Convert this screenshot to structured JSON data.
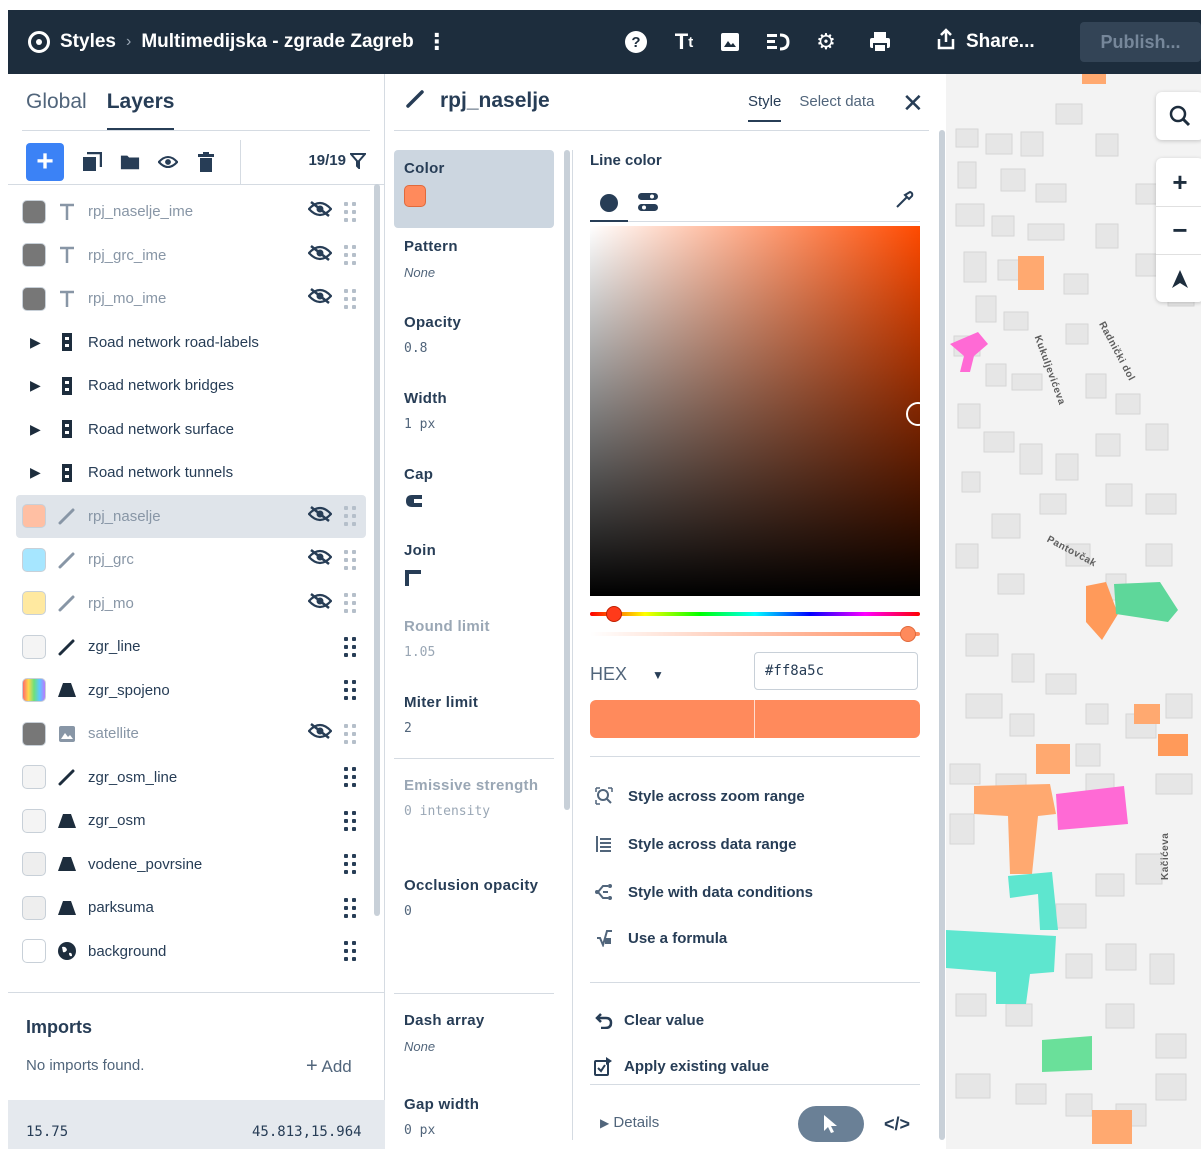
{
  "topbar": {
    "app": "Styles",
    "separator": ">",
    "project": "Multimedijska - zgrade Zagreb",
    "share": "Share...",
    "publish": "Publish...",
    "icons": [
      "help-icon",
      "typography-icon",
      "image-icon",
      "import-icon",
      "settings-icon",
      "print-icon",
      "share-icon"
    ]
  },
  "left": {
    "tabs": [
      "Global",
      "Layers"
    ],
    "active_tab": "Layers",
    "count": "19/19",
    "layers": [
      {
        "name": "rpj_naselje_ime",
        "icon": "text",
        "swatch": "#777777",
        "hidden": true
      },
      {
        "name": "rpj_grc_ime",
        "icon": "text",
        "swatch": "#777777",
        "hidden": true
      },
      {
        "name": "rpj_mo_ime",
        "icon": "text",
        "swatch": "#777777",
        "hidden": true
      },
      {
        "name": "Road network road-labels",
        "icon": "group",
        "group": true
      },
      {
        "name": "Road network bridges",
        "icon": "group",
        "group": true
      },
      {
        "name": "Road network surface",
        "icon": "group",
        "group": true
      },
      {
        "name": "Road network tunnels",
        "icon": "group",
        "group": true
      },
      {
        "name": "rpj_naselje",
        "icon": "line",
        "swatch": "#ffbfa3",
        "hidden": true,
        "selected": true
      },
      {
        "name": "rpj_grc",
        "icon": "line",
        "swatch": "#a6e6ff",
        "hidden": true
      },
      {
        "name": "rpj_mo",
        "icon": "line",
        "swatch": "#ffe9a0",
        "hidden": true
      },
      {
        "name": "zgr_line",
        "icon": "line",
        "swatch": "#f4f4f4"
      },
      {
        "name": "zgr_spojeno",
        "icon": "fill",
        "swatch": "rainbow"
      },
      {
        "name": "satellite",
        "icon": "raster",
        "swatch": "#777777",
        "hidden": true
      },
      {
        "name": "zgr_osm_line",
        "icon": "line",
        "swatch": "#f4f4f4"
      },
      {
        "name": "zgr_osm",
        "icon": "fill",
        "swatch": "#f4f4f4"
      },
      {
        "name": "vodene_povrsine",
        "icon": "fill",
        "swatch": "#eeeeee"
      },
      {
        "name": "parksuma",
        "icon": "fill",
        "swatch": "#eeeeee"
      },
      {
        "name": "background",
        "icon": "globe",
        "swatch": "#ffffff"
      }
    ],
    "imports": {
      "title": "Imports",
      "none": "No imports found.",
      "add": "Add"
    },
    "status": {
      "zoom": "15.75",
      "coords": "45.813,15.964"
    }
  },
  "mid": {
    "layer_name": "rpj_naselje",
    "tabs": [
      "Style",
      "Select data"
    ],
    "active_tab": "Style",
    "props": [
      {
        "label": "Color",
        "type": "swatch",
        "value": "#ff8a5c",
        "selected": true
      },
      {
        "label": "Pattern",
        "value": "None",
        "italic": true
      },
      {
        "label": "Opacity",
        "value": "0.8",
        "mono": true
      },
      {
        "label": "Width",
        "value": "1 px",
        "mono": true
      },
      {
        "label": "Cap",
        "value": "cap-icon",
        "type": "icon"
      },
      {
        "label": "Join",
        "value": "join-icon",
        "type": "icon"
      },
      {
        "label": "Round limit",
        "value": "1.05",
        "mono": true,
        "dim": true
      },
      {
        "label": "Miter limit",
        "value": "2",
        "mono": true
      },
      {
        "label": "Emissive strength",
        "value": "0 intensity",
        "mono": true,
        "dim": true,
        "sep": true
      },
      {
        "label": "Occlusion opacity",
        "value": "0",
        "mono": true
      },
      {
        "label": "Dash array",
        "value": "None",
        "italic": true,
        "sep": true
      },
      {
        "label": "Gap width",
        "value": "0 px",
        "mono": true
      }
    ],
    "editor": {
      "title": "Line color",
      "hex_label": "HEX",
      "hex_value": "#ff8a5c",
      "color": "#ff8a5c",
      "options": [
        {
          "label": "Style across zoom range",
          "icon": "zoom-range-icon"
        },
        {
          "label": "Style across data range",
          "icon": "data-range-icon"
        },
        {
          "label": "Style with data conditions",
          "icon": "data-conditions-icon"
        },
        {
          "label": "Use a formula",
          "icon": "formula-icon"
        }
      ],
      "actions": [
        {
          "label": "Clear value",
          "icon": "undo-icon"
        },
        {
          "label": "Apply existing value",
          "icon": "apply-value-icon"
        }
      ],
      "details": "Details"
    }
  },
  "map": {
    "streets": [
      "Kukuljevićeva",
      "Radnički dol",
      "Pantovčak",
      "Kačićeva"
    ]
  }
}
